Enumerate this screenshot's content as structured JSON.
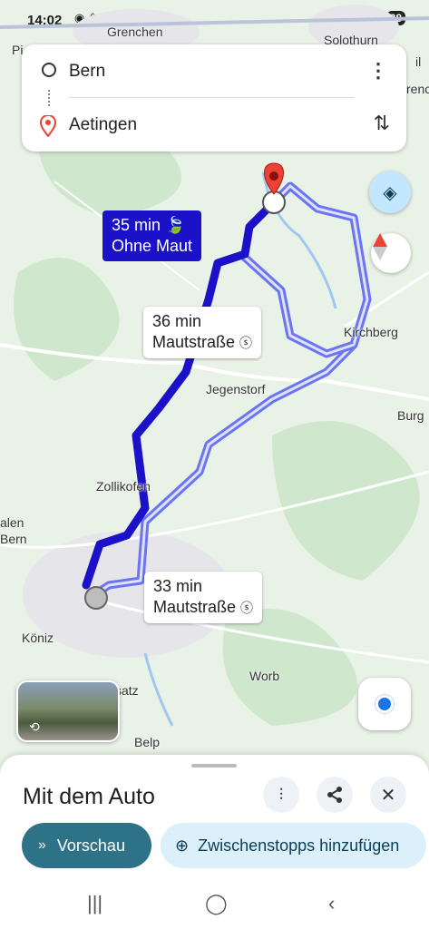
{
  "status": {
    "time": "14:02",
    "signal": "5G",
    "battery": "88"
  },
  "search": {
    "origin": "Bern",
    "destination": "Aetingen"
  },
  "routes": [
    {
      "time": "35 min",
      "note": "Ohne Maut",
      "selected": true
    },
    {
      "time": "36 min",
      "note": "Mautstraße",
      "selected": false
    },
    {
      "time": "33 min",
      "note": "Mautstraße",
      "selected": false
    }
  ],
  "places": [
    "Grenchen",
    "Solothurn",
    "Kirchberg",
    "Jegenstorf",
    "Burg",
    "Zollikofen",
    "alen",
    "Bern",
    "Köniz",
    "Worb",
    "Belp",
    "satz",
    "Pi",
    "renc",
    "il"
  ],
  "sheet": {
    "title": "Mit dem Auto",
    "preview": "Vorschau",
    "add_stops": "Zwischenstopps hinzufügen"
  },
  "icons": {
    "filter": "tune-icon",
    "share": "share-icon",
    "close": "close-icon",
    "layers": "layers-icon",
    "compass": "compass-icon",
    "locate": "my-location-icon"
  },
  "colors": {
    "route_selected": "#1b11c8",
    "route_alt": "#6b75f2",
    "preview": "#2e7287",
    "pin": "#ea4335"
  }
}
